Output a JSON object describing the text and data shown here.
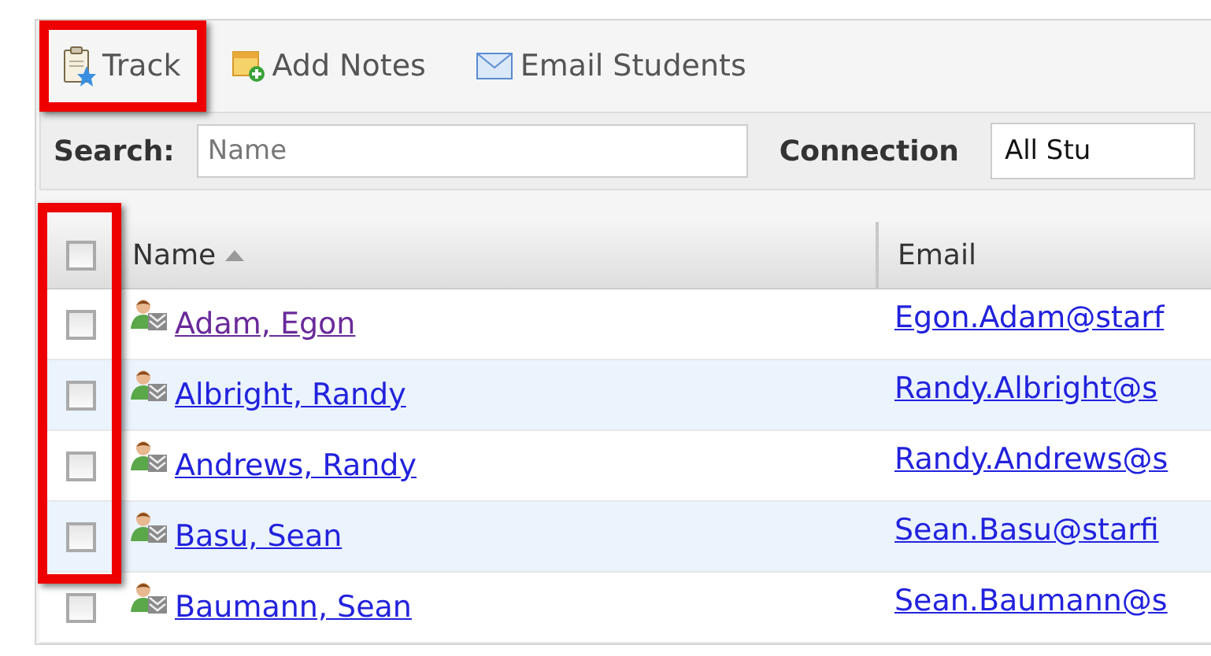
{
  "toolbar": [
    {
      "kind": "track",
      "label": "Track",
      "highlighted": true
    },
    {
      "kind": "notes",
      "label": "Add Notes",
      "highlighted": false
    },
    {
      "kind": "email",
      "label": "Email Students",
      "highlighted": false
    }
  ],
  "search": {
    "label": "Search:",
    "placeholder": "Name"
  },
  "connection": {
    "label": "Connection",
    "value": "All Stu"
  },
  "table": {
    "columns": [
      {
        "label": "Name",
        "sorted": true
      },
      {
        "label": "Email",
        "sorted": false
      }
    ],
    "select_column_highlighted": true,
    "header_checked": false,
    "rows": [
      {
        "checked": false,
        "name": "Adam, Egon",
        "visited": true,
        "email": "Egon.Adam@starf"
      },
      {
        "checked": false,
        "name": "Albright, Randy",
        "visited": false,
        "email": "Randy.Albright@s"
      },
      {
        "checked": false,
        "name": "Andrews, Randy",
        "visited": false,
        "email": "Randy.Andrews@s"
      },
      {
        "checked": false,
        "name": "Basu, Sean",
        "visited": false,
        "email": "Sean.Basu@starfi"
      },
      {
        "checked": false,
        "name": "Baumann, Sean",
        "visited": false,
        "email": "Sean.Baumann@s"
      }
    ]
  }
}
